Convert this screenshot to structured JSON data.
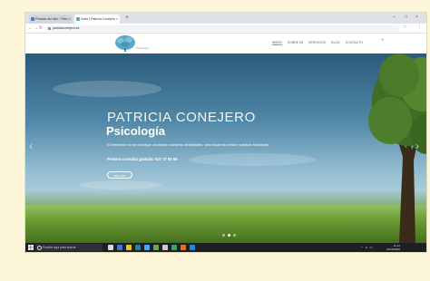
{
  "browser": {
    "tabs": [
      {
        "label": "Portada del sitio ‹ Patri..."
      },
      {
        "label": "Inicio | Patricia Conejero"
      }
    ],
    "new_tab": "+",
    "url": "patriciaconejero.es",
    "window_controls": {
      "minimize": "–",
      "maximize": "□",
      "close": "×"
    }
  },
  "site": {
    "logo_tag": "Psicología",
    "nav": [
      "INICIO",
      "SOBRE MÍ",
      "SERVICIOS",
      "BLOG",
      "CONTACTO"
    ]
  },
  "hero": {
    "name": "PATRICIA CONEJERO",
    "subtitle": "Psicología",
    "text": "El bienestar no se consigue ocultando nuestras debilidades, sino haciendo brillar nuestras fortalezas.",
    "offer": "Primera consulta gratuita: 627 37 80 56",
    "button": "VER MÁS",
    "prev": "‹",
    "next": "›"
  },
  "taskbar": {
    "search_placeholder": "Escribe aquí para buscar",
    "time": "11:12",
    "date": "29/06/2020",
    "app_colors": [
      "#d9d9d9",
      "#3a7bd5",
      "#f0c419",
      "#2d7d9a",
      "#3fa9f5",
      "#6aa84f",
      "#cccccc",
      "#34a853",
      "#e8710a",
      "#1e88e5"
    ]
  },
  "colors": {
    "accent": "#5aa8c8",
    "page_background": "#fdf6d8",
    "taskbar": "#1c1f24"
  }
}
